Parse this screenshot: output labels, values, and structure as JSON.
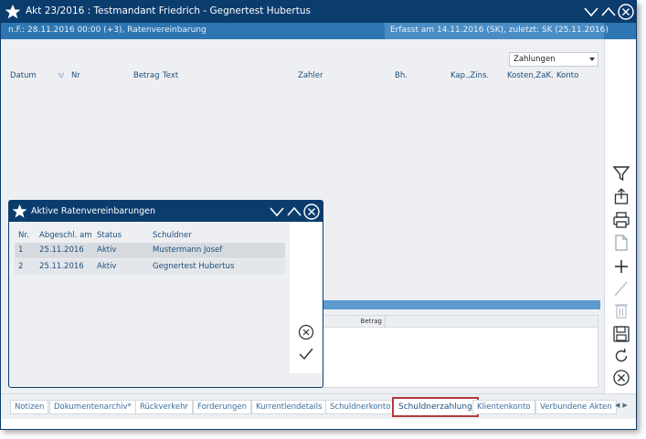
{
  "window": {
    "title": "Akt 23/2016 : Testmandant Friedrich - Gegnertest Hubertus",
    "info_left": "n.F.: 28.11.2016 00:00 (+3), Ratenvereinbarung",
    "info_right": "Erfasst am 14.11.2016 (SK), zuletzt: SK (25.11.2016)"
  },
  "filter": {
    "selected": "Zahlungen"
  },
  "columns": [
    "Datum",
    "Nr",
    "Betrag",
    "Text",
    "Zahler",
    "Bh.",
    "Kap.,Zins.",
    "Kosten,ZaK.",
    "Konto"
  ],
  "subgrid": {
    "column": "Betrag"
  },
  "dialog": {
    "title": "Aktive Ratenvereinbarungen",
    "columns": [
      "Nr.",
      "Abgeschl. am",
      "Status",
      "Schuldner"
    ],
    "rows": [
      [
        "1",
        "25.11.2016",
        "Aktiv",
        "Mustermann Josef"
      ],
      [
        "2",
        "25.11.2016",
        "Aktiv",
        "Gegnertest Hubertus"
      ]
    ]
  },
  "tabs": [
    "Notizen",
    "Dokumentenarchiv*",
    "Rückverkehr",
    "Forderungen",
    "Kurrentlendetails",
    "Schuldnerkonto",
    "Schuldnerzahlung",
    "Klientenkonto",
    "Verbundene Akten"
  ],
  "active_tab": "Schuldnerzahlung",
  "sidebar_icons": [
    "filter-icon",
    "export-icon",
    "print-icon",
    "new-document-icon",
    "add-icon",
    "edit-icon",
    "delete-icon",
    "save-icon",
    "refresh-icon",
    "close-icon"
  ],
  "colors": {
    "titlebar": "#0b3c6e",
    "infobar": "#2e76b2",
    "accent_text": "#1f4e79",
    "active_tab_border": "#b03a3a"
  }
}
